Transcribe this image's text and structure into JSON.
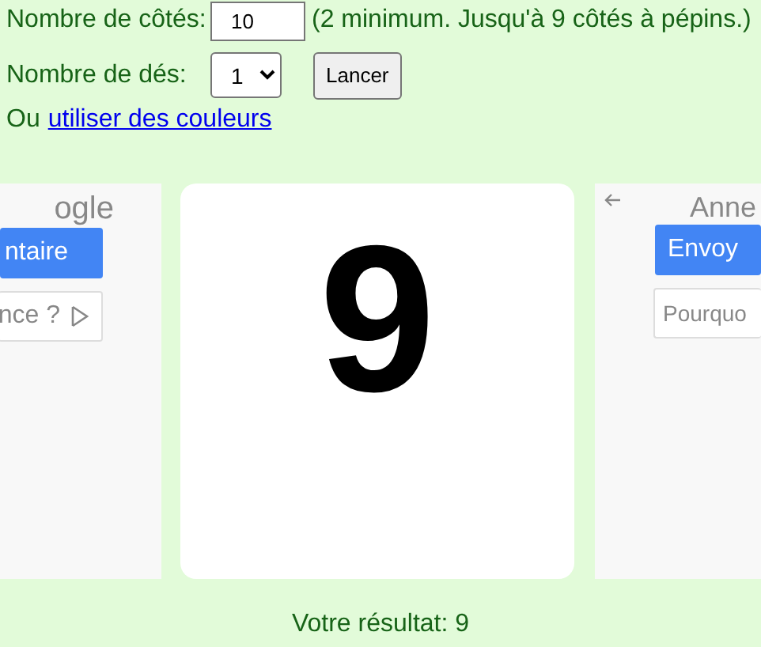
{
  "form": {
    "sides_label": "Nombre de côtés:",
    "sides_value": "10",
    "sides_hint": "(2 minimum. Jusqu'à 9 côtés à pépins.)",
    "dice_label": "Nombre de dés:",
    "dice_value": "1",
    "roll_button": "Lancer",
    "colors_prefix": "Ou",
    "colors_link": "utiliser des couleurs"
  },
  "left_ad": {
    "title": "ogle",
    "primary_button": "ntaire",
    "secondary_button": "nce ?"
  },
  "die": {
    "value": "9"
  },
  "right_ad": {
    "title": "Anne",
    "primary_button": "Envoy",
    "secondary_button": "Pourquo"
  },
  "result": "Votre résultat: 9"
}
